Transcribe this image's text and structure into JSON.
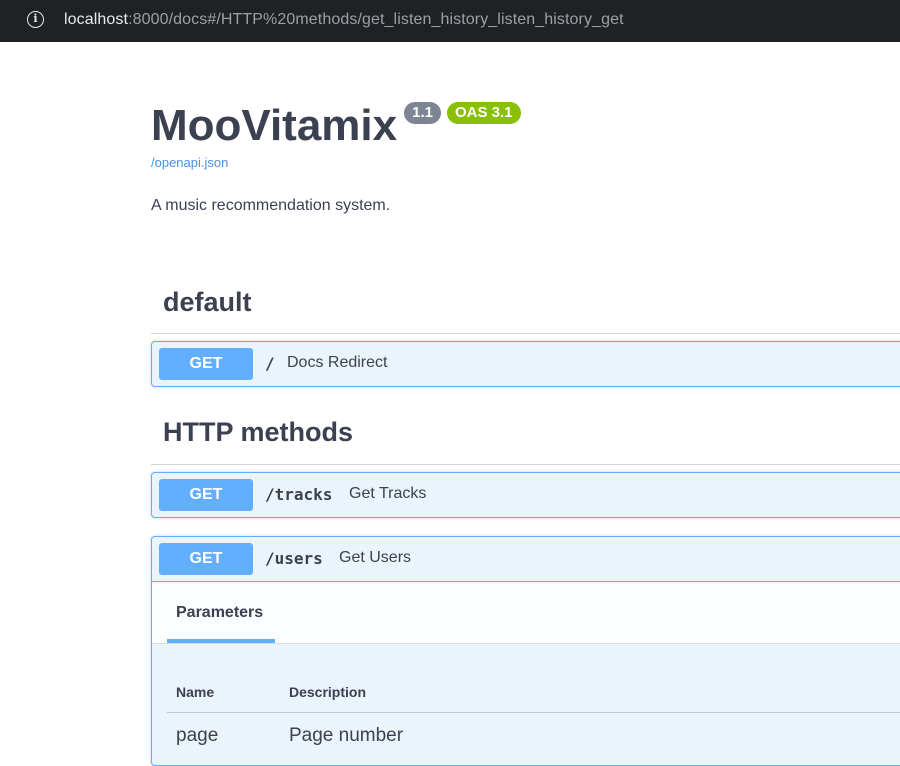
{
  "browser": {
    "url_host": "localhost",
    "url_rest": ":8000/docs#/HTTP%20methods/get_listen_history_listen_history_get",
    "info_icon": "info-icon"
  },
  "api": {
    "title": "MooVitamix",
    "version_badge": "1.1",
    "oas_badge": "OAS 3.1",
    "spec_link": "/openapi.json",
    "description": "A music recommendation system."
  },
  "sections": [
    {
      "heading": "default",
      "operations": [
        {
          "method": "GET",
          "path": "/",
          "summary": "Docs Redirect"
        }
      ]
    },
    {
      "heading": "HTTP methods",
      "operations": [
        {
          "method": "GET",
          "path": "/tracks",
          "summary": "Get Tracks"
        },
        {
          "method": "GET",
          "path": "/users",
          "summary": "Get Users",
          "expanded": {
            "tab": "Parameters",
            "columns": [
              "Name",
              "Description"
            ],
            "rows": [
              {
                "name": "page",
                "description": "Page number"
              }
            ]
          }
        }
      ]
    }
  ],
  "colors": {
    "get_method": "#61affe",
    "oas_badge": "#89bf04",
    "version_badge": "#7d8492",
    "title_text": "#3b4151",
    "link": "#4990e2"
  }
}
